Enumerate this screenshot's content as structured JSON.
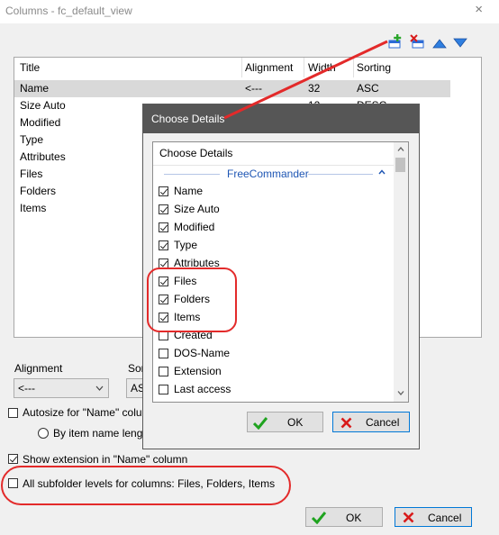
{
  "window": {
    "title": "Columns - fc_default_view",
    "close": "×"
  },
  "toolbar": {
    "icons": [
      "add-column-icon",
      "remove-column-icon",
      "move-up-icon",
      "move-down-icon"
    ]
  },
  "columns_list": {
    "headers": [
      "Title",
      "Alignment",
      "Width",
      "Sorting"
    ],
    "rows": [
      {
        "title": "Name",
        "alignment": "<---",
        "width": "32",
        "sorting": "ASC"
      },
      {
        "title": "Size Auto",
        "alignment": "",
        "width": "12",
        "sorting": "DESC"
      },
      {
        "title": "Modified",
        "alignment": "",
        "width": "",
        "sorting": ""
      },
      {
        "title": "Type",
        "alignment": "",
        "width": "",
        "sorting": ""
      },
      {
        "title": "Attributes",
        "alignment": "",
        "width": "",
        "sorting": ""
      },
      {
        "title": "Files",
        "alignment": "",
        "width": "",
        "sorting": ""
      },
      {
        "title": "Folders",
        "alignment": "",
        "width": "",
        "sorting": ""
      },
      {
        "title": "Items",
        "alignment": "",
        "width": "",
        "sorting": ""
      }
    ]
  },
  "alignment": {
    "label": "Alignment",
    "value": "<---"
  },
  "sorting": {
    "label": "Sor",
    "value": "AS"
  },
  "autosize": {
    "label": "Autosize for \"Name\" colu",
    "checked": false
  },
  "by_item": {
    "label": "By item name lengt"
  },
  "show_extension": {
    "label": "Show extension in \"Name\" column",
    "checked": true
  },
  "subfolder_levels": {
    "label": "All subfolder levels for columns:  Files, Folders, Items",
    "checked": false
  },
  "buttons": {
    "ok": "OK",
    "cancel": "Cancel"
  },
  "dialog": {
    "title": "Choose Details",
    "list_header": "Choose Details",
    "group": "FreeCommander",
    "items": [
      {
        "label": "Name",
        "checked": true
      },
      {
        "label": "Size Auto",
        "checked": true
      },
      {
        "label": "Modified",
        "checked": true
      },
      {
        "label": "Type",
        "checked": true
      },
      {
        "label": "Attributes",
        "checked": true
      },
      {
        "label": "Files",
        "checked": true
      },
      {
        "label": "Folders",
        "checked": true
      },
      {
        "label": "Items",
        "checked": true
      },
      {
        "label": "Created",
        "checked": false
      },
      {
        "label": "DOS-Name",
        "checked": false
      },
      {
        "label": "Extension",
        "checked": false
      },
      {
        "label": "Last access",
        "checked": false
      }
    ],
    "ok": "OK",
    "cancel": "Cancel"
  },
  "colors": {
    "annotation_red": "#e32a2a",
    "dialog_titlebar": "#565656",
    "group_blue": "#1e56b4",
    "ok_green": "#1fa31f",
    "cancel_red": "#d81b1b"
  }
}
